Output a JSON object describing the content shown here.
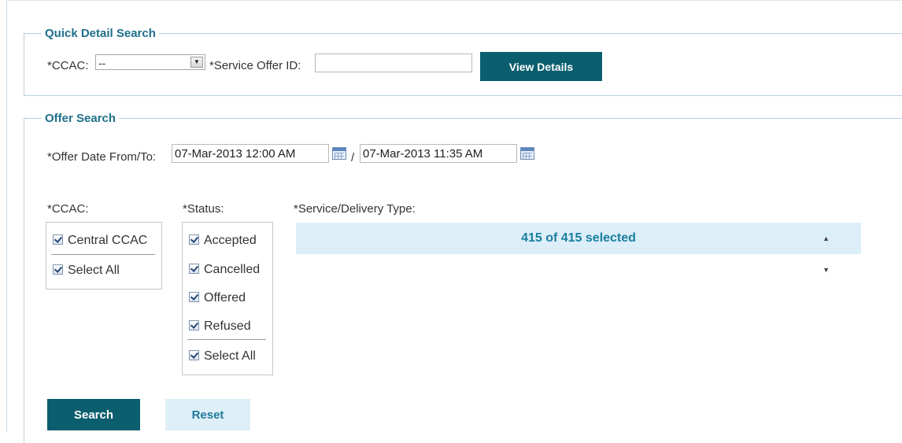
{
  "quick_search": {
    "legend": "Quick Detail Search",
    "ccac_label": "*CCAC:",
    "ccac_value": "--",
    "service_offer_label": "*Service Offer ID:",
    "service_offer_value": "",
    "view_details_label": "View Details"
  },
  "offer_search": {
    "legend": "Offer Search",
    "date_label": "*Offer Date From/To:",
    "date_from": "07-Mar-2013 12:00 AM",
    "date_separator": "/",
    "date_to": "07-Mar-2013 11:35 AM",
    "ccac_label": "*CCAC:",
    "ccac_options": [
      {
        "label": "Central CCAC",
        "checked": true
      },
      {
        "label": "Select All",
        "checked": true
      }
    ],
    "status_label": "*Status:",
    "status_options": [
      {
        "label": "Accepted",
        "checked": true
      },
      {
        "label": "Cancelled",
        "checked": true
      },
      {
        "label": "Offered",
        "checked": true
      },
      {
        "label": "Refused",
        "checked": true
      },
      {
        "label": "Select All",
        "checked": true
      }
    ],
    "service_type_label": "*Service/Delivery Type:",
    "service_type_value": "415 of 415 selected",
    "search_label": "Search",
    "reset_label": "Reset"
  },
  "icons": {
    "calendar": "calendar-icon",
    "dropdown": "chevron-down-icon",
    "sort": "up-down-arrows-icon"
  },
  "colors": {
    "accent": "#0b5e6e",
    "legend": "#1f6f8b",
    "multiselect_bg": "#dceef8",
    "multiselect_text": "#1a7fa0"
  }
}
